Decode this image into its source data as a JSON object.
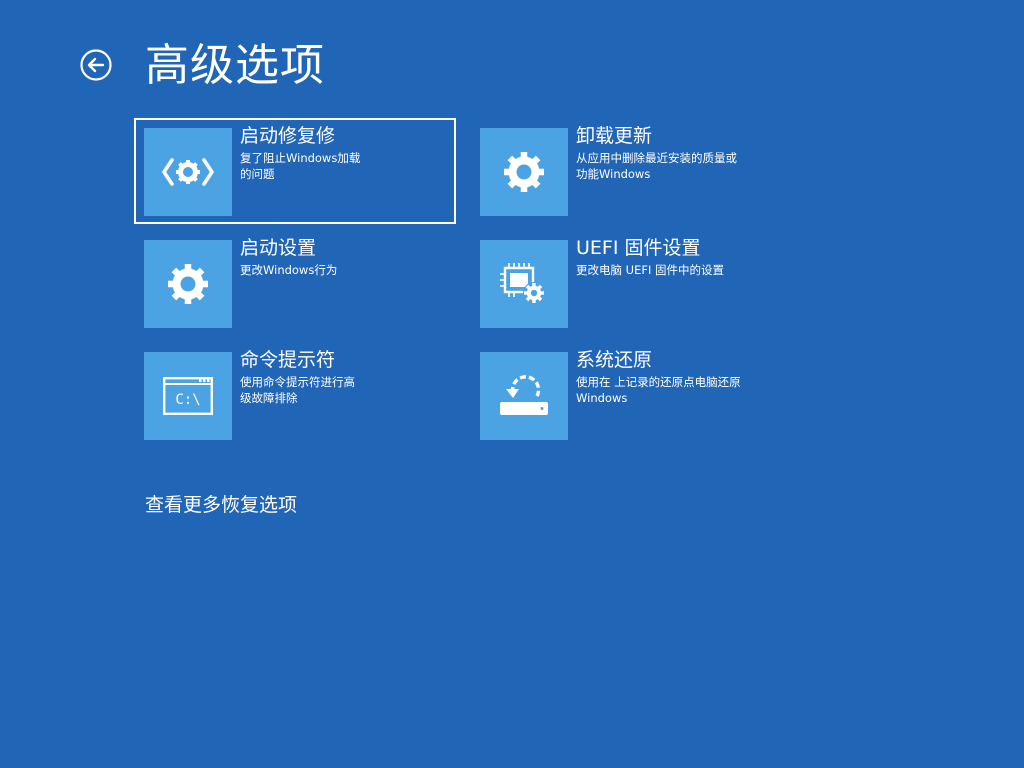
{
  "header": {
    "title": "高级选项"
  },
  "options": [
    {
      "label": "启动修复修",
      "desc": "复了阻止Windows加载的问题",
      "icon": "startup-repair-icon",
      "selected": true
    },
    {
      "label": "卸载更新",
      "desc": "从应用中删除最近安装的质量或功能Windows",
      "icon": "gear-icon"
    },
    {
      "label": "启动设置",
      "desc": "更改Windows行为",
      "icon": "gear-icon"
    },
    {
      "label": "UEFI 固件设置",
      "desc": "更改电脑 UEFI 固件中的设置",
      "icon": "firmware-chip-gear-icon"
    },
    {
      "label": "命令提示符",
      "desc": "使用命令提示符进行高级故障排除",
      "icon": "command-prompt-icon",
      "glyph": "C:\\"
    },
    {
      "label": "系统还原",
      "desc": "使用在 上记录的还原点电脑还原Windows",
      "icon": "system-restore-icon"
    }
  ],
  "footer": {
    "more_options": "查看更多恢复选项"
  },
  "colors": {
    "background": "#2165b6",
    "tile": "#4ba3e3",
    "text": "#ffffff"
  }
}
